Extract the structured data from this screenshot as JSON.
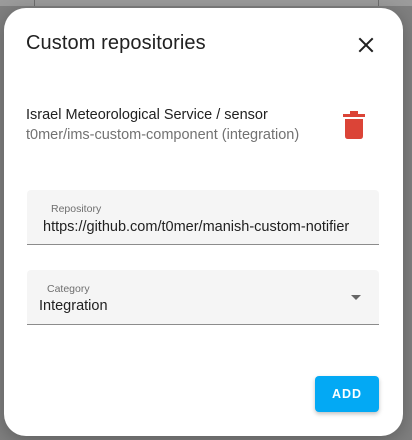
{
  "dialog": {
    "title": "Custom repositories",
    "colors": {
      "accent": "#03a9f4",
      "delete": "#db4437"
    }
  },
  "repositories": [
    {
      "name": "Israel Meteorological Service / sensor",
      "path": "t0mer/ims-custom-component (integration)"
    }
  ],
  "form": {
    "repository": {
      "label": "Repository",
      "value": "https://github.com/t0mer/manish-custom-notifier"
    },
    "category": {
      "label": "Category",
      "value": "Integration"
    },
    "add_label": "ADD"
  },
  "icons": {
    "close": "close-icon",
    "delete": "trash-icon",
    "dropdown": "chevron-down-icon"
  }
}
